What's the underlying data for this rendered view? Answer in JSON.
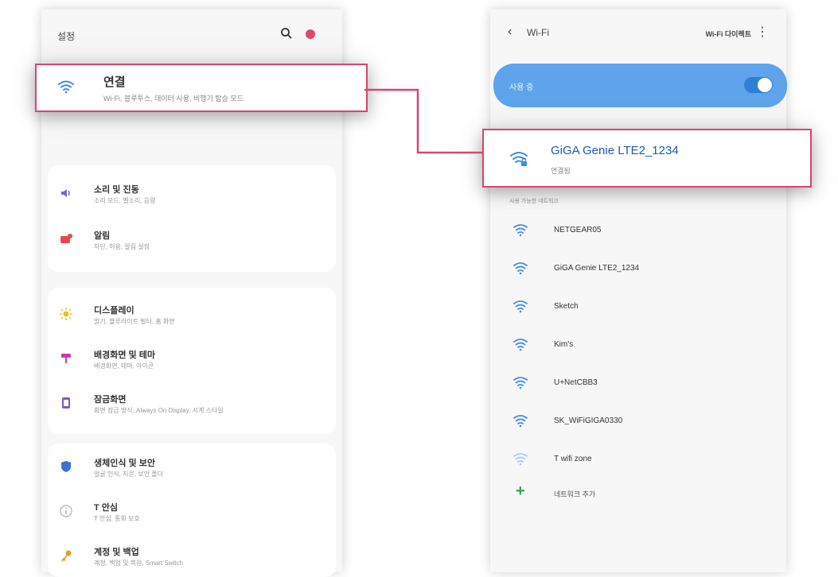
{
  "left": {
    "title": "설정",
    "highlight": {
      "title": "연결",
      "subtitle": "Wi-Fi, 블루투스, 데이터 사용, 비행기 탑승 모드"
    },
    "groups": [
      [
        {
          "title": "소리 및 진동",
          "subtitle": "소리 모드, 벨소리, 음량",
          "icon": "volume-icon",
          "color": "#6b6bd6"
        },
        {
          "title": "알림",
          "subtitle": "차단, 허용, 알림 설정",
          "icon": "notification-icon",
          "color": "#e8484f"
        }
      ],
      [
        {
          "title": "디스플레이",
          "subtitle": "밝기, 블루라이트 필터, 홈 화면",
          "icon": "brightness-icon",
          "color": "#e6c419"
        },
        {
          "title": "배경화면 및 테마",
          "subtitle": "배경화면, 테마, 아이콘",
          "icon": "theme-icon",
          "color": "#c93ca6"
        },
        {
          "title": "잠금화면",
          "subtitle": "화면 잠금 방식, Always On Display, 시계 스타일",
          "icon": "lock-screen-icon",
          "color": "#7f57c7"
        }
      ],
      [
        {
          "title": "생체인식 및 보안",
          "subtitle": "얼굴 인식, 지문, 보안 폴더",
          "icon": "shield-icon",
          "color": "#3f6fd1"
        },
        {
          "title": "T 안심",
          "subtitle": "T 안심, 통화 보호",
          "icon": "info-icon",
          "color": "#b9b9b9"
        },
        {
          "title": "계정 및 백업",
          "subtitle": "계정, 백업 및 복원, Smart Switch",
          "icon": "key-icon",
          "color": "#e79a2c"
        }
      ]
    ]
  },
  "right": {
    "title": "Wi-Fi",
    "direct_label": "Wi-Fi 다이렉트",
    "toggle": {
      "label": "사용 중",
      "on": true
    },
    "highlight": {
      "name": "GiGA Genie LTE2_1234",
      "status": "연결됨"
    },
    "section_label": "사용 가능한 네트워크",
    "networks": [
      "NETGEAR05",
      "GiGA Genie LTE2_1234",
      "Sketch",
      "Kim's",
      "U+NetCBB3",
      "SK_WiFiGIGA0330",
      "T wifi zone"
    ],
    "add_network": "네트워크 추가"
  },
  "colors": {
    "highlight_border": "#d6476f",
    "toggle_bar": "#5ea4ec",
    "connected_text": "#1e57b4",
    "wifi_icon": "#3f8de0"
  }
}
